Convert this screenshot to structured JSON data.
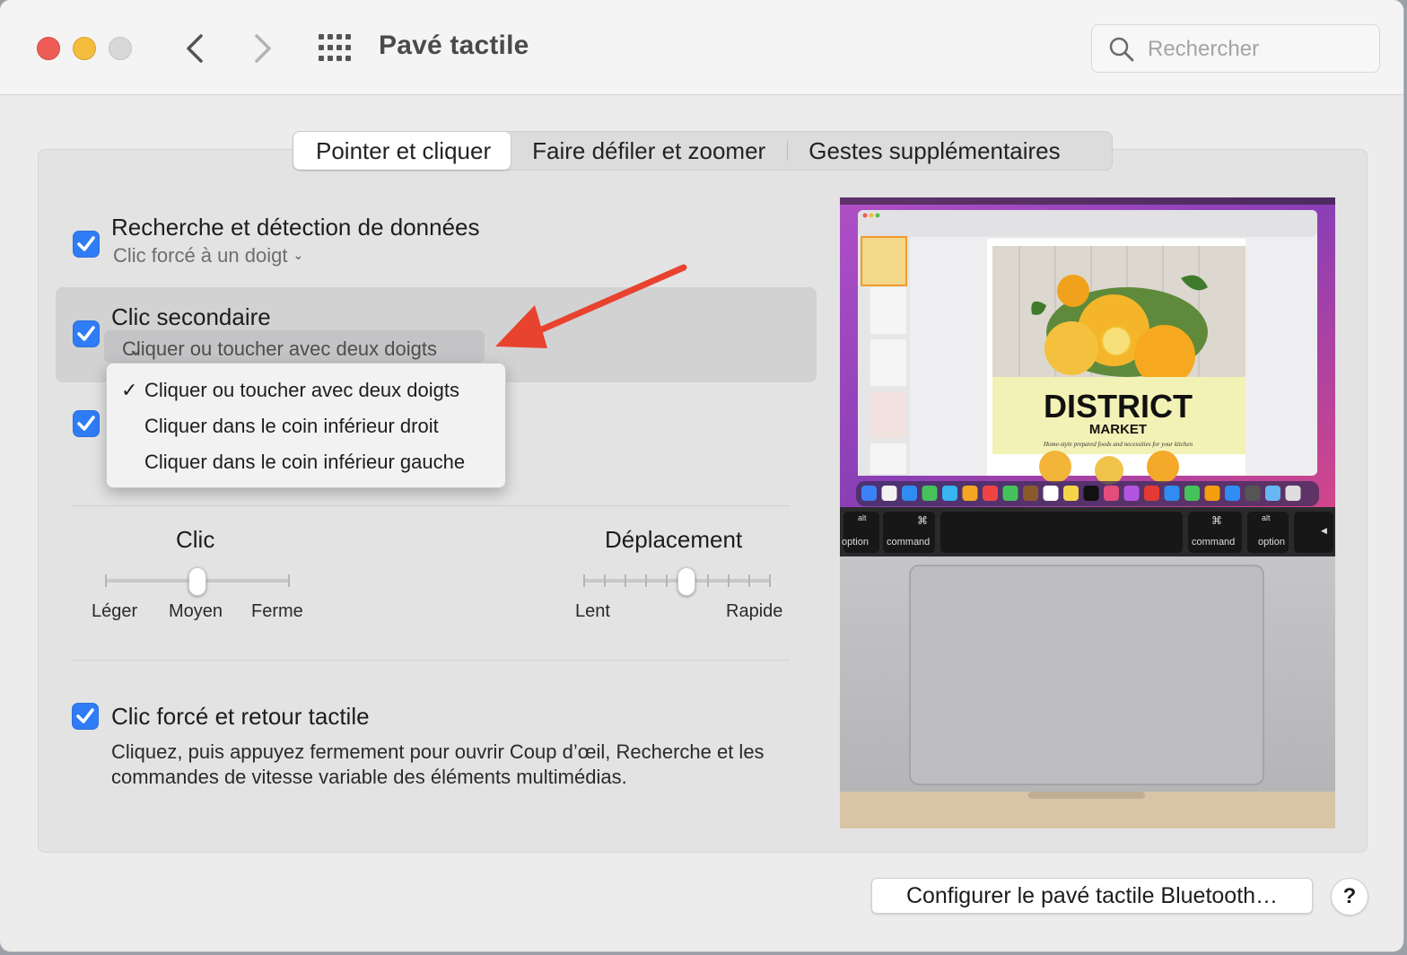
{
  "window": {
    "title": "Pavé tactile"
  },
  "search": {
    "placeholder": "Rechercher"
  },
  "tabs": [
    {
      "label": "Pointer et cliquer",
      "active": true
    },
    {
      "label": "Faire défiler et zoomer",
      "active": false
    },
    {
      "label": "Gestes supplémentaires",
      "active": false
    }
  ],
  "options": {
    "lookup": {
      "label": "Recherche et détection de données",
      "value": "Clic forcé à un doigt",
      "checked": true
    },
    "secondary": {
      "label": "Clic secondaire",
      "value": "Cliquer ou toucher avec deux doigts",
      "checked": true
    },
    "third": {
      "checked": true
    },
    "force_click": {
      "label": "Clic forcé et retour tactile",
      "description": "Cliquez, puis appuyez fermement pour ouvrir Coup d’œil, Recherche et les commandes de vitesse variable des éléments multimédias.",
      "checked": true
    }
  },
  "dropdown_menu": {
    "items": [
      {
        "label": "Cliquer ou toucher avec deux doigts",
        "selected": true
      },
      {
        "label": "Cliquer dans le coin inférieur droit",
        "selected": false
      },
      {
        "label": "Cliquer dans le coin inférieur gauche",
        "selected": false
      }
    ]
  },
  "click_slider": {
    "title": "Clic",
    "labels": [
      "Léger",
      "Moyen",
      "Ferme"
    ],
    "value": "Moyen"
  },
  "tracking_slider": {
    "title": "Déplacement",
    "min_label": "Lent",
    "max_label": "Rapide",
    "value_fraction": 0.5
  },
  "preview": {
    "poster_title": "DISTRICT",
    "poster_subtitle": "MARKET",
    "poster_tagline": "Home-style prepared foods and necessities for your kitchen",
    "keys": [
      "alt",
      "option",
      "command",
      "command",
      "alt",
      "option"
    ]
  },
  "footer": {
    "bluetooth_button": "Configurer le pavé tactile Bluetooth…",
    "help_button": "?"
  },
  "colors": {
    "accent": "#2f7cf6",
    "arrow": "#e8432f"
  }
}
